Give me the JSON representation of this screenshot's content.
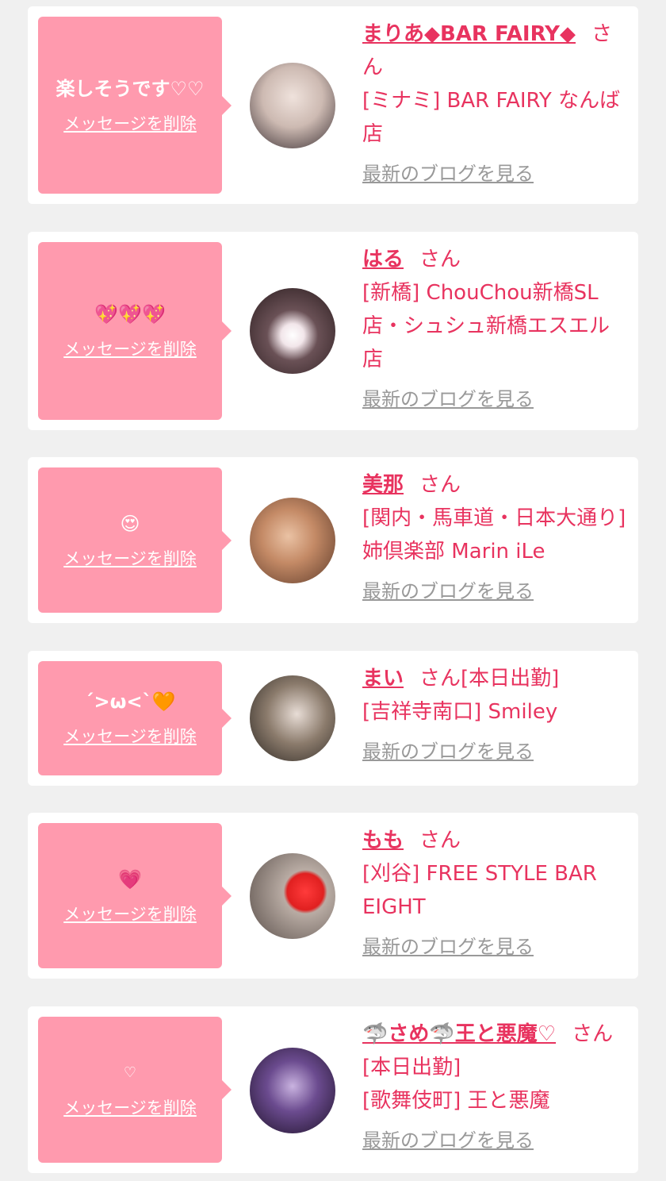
{
  "cards": [
    {
      "message": "楽しそうです♡♡",
      "delete_label": "メッセージを削除",
      "name": "まりあ◆BAR FAIRY◆",
      "honorific": "さん",
      "attendance": "",
      "shop": "[ミナミ] BAR FAIRY なんば店",
      "blog_label": "最新のブログを見る",
      "avatar_colors": [
        "#d9c9c2",
        "#3a2f33"
      ]
    },
    {
      "message": "💖💖💖",
      "delete_label": "メッセージを削除",
      "name": "はる",
      "honorific": "さん",
      "attendance": "",
      "shop": "[新橋] ChouChou新橋SL店・シュシュ新橋エスエル店",
      "blog_label": "最新のブログを見る",
      "avatar_colors": [
        "#5a4346",
        "#2a1c1e"
      ]
    },
    {
      "message": "😍",
      "delete_label": "メッセージを削除",
      "name": "美那",
      "honorific": "さん",
      "attendance": "",
      "shop": "[関内・馬車道・日本大通り] 姉倶楽部 Marin iLe",
      "blog_label": "最新のブログを見る",
      "avatar_colors": [
        "#c48a66",
        "#5e3b2a"
      ]
    },
    {
      "message": "´>ω<`🧡",
      "delete_label": "メッセージを削除",
      "name": "まい",
      "honorific": "さん",
      "attendance": "[本日出勤]",
      "shop": "[吉祥寺南口] Smiley",
      "blog_label": "最新のブログを見る",
      "avatar_colors": [
        "#8b7b6c",
        "#2b2622"
      ]
    },
    {
      "message": "💗",
      "delete_label": "メッセージを削除",
      "name": "もも",
      "honorific": "さん",
      "attendance": "",
      "shop": "[刈谷] FREE STYLE BAR EIGHT",
      "blog_label": "最新のブログを見る",
      "avatar_colors": [
        "#b9aca4",
        "#5a4f4a"
      ]
    },
    {
      "message": "♡",
      "delete_label": "メッセージを削除",
      "name": "🦈さめ🦈王と悪魔♡",
      "honorific": "さん",
      "attendance": "[本日出勤]",
      "shop": "[歌舞伎町] 王と悪魔",
      "blog_label": "最新のブログを見る",
      "avatar_colors": [
        "#6b4b8f",
        "#1e1228"
      ]
    }
  ],
  "theme": {
    "page_bg": "#f0f0f0",
    "card_bg": "#ffffff",
    "bubble_bg": "#ff9aae",
    "accent": "#e8335f",
    "muted": "#999999"
  }
}
